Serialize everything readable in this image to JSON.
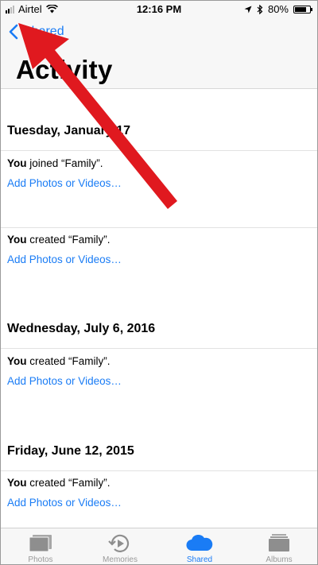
{
  "status_bar": {
    "carrier": "Airtel",
    "time": "12:16 PM",
    "battery": "80%",
    "battery_level": 0.8
  },
  "nav": {
    "back_label": "Shared",
    "title": "Activity"
  },
  "sections": [
    {
      "date": "Tuesday, January 17",
      "items": [
        {
          "actor": "You",
          "text": " joined “Family”.",
          "link": "Add Photos or Videos…"
        },
        {
          "actor": "You",
          "text": " created “Family”.",
          "link": "Add Photos or Videos…"
        }
      ]
    },
    {
      "date": "Wednesday, July 6, 2016",
      "items": [
        {
          "actor": "You",
          "text": " created “Family”.",
          "link": "Add Photos or Videos…"
        }
      ]
    },
    {
      "date": "Friday, June 12, 2015",
      "items": [
        {
          "actor": "You",
          "text": " created “Family”.",
          "link": "Add Photos or Videos…"
        }
      ]
    }
  ],
  "tabs": [
    {
      "label": "Photos",
      "icon": "photos-icon",
      "active": false
    },
    {
      "label": "Memories",
      "icon": "memories-icon",
      "active": false
    },
    {
      "label": "Shared",
      "icon": "cloud-icon",
      "active": true
    },
    {
      "label": "Albums",
      "icon": "albums-icon",
      "active": false
    }
  ],
  "colors": {
    "accent": "#1a7cf5",
    "annotation_arrow": "#e0191f",
    "inactive_tab": "#9a9a9a"
  }
}
